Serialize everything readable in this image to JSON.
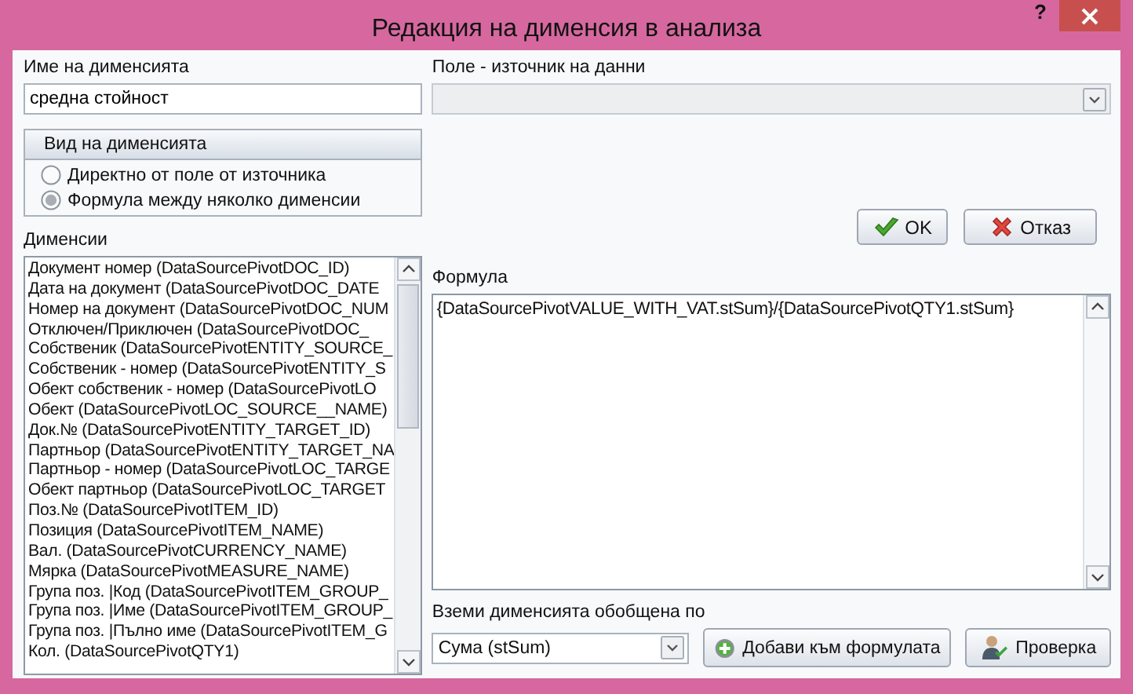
{
  "window": {
    "title": "Редакция на дименсия в анализа",
    "help": "?"
  },
  "name_field": {
    "label": "Име на дименсията",
    "value": "средна стойност"
  },
  "source_field": {
    "label": "Поле - източник на данни",
    "disabled": true
  },
  "dimension_type": {
    "title": "Вид на дименсията",
    "options": [
      {
        "label": "Директно от поле от източника",
        "selected": false
      },
      {
        "label": "Формула между няколко дименсии",
        "selected": true
      }
    ]
  },
  "buttons": [
    {
      "kind": "ok",
      "label": "OK"
    },
    {
      "kind": "cancel",
      "label": "Отказ"
    }
  ],
  "dimensions": {
    "label": "Дименсии",
    "items": [
      "Документ номер (DataSourcePivotDOC_ID)",
      "Дата на документ (DataSourcePivotDOC_DATE",
      "Номер на документ (DataSourcePivotDOC_NUM",
      "Отключен/Приключен (DataSourcePivotDOC_",
      "Собственик (DataSourcePivotENTITY_SOURCE_",
      "Собственик - номер (DataSourcePivotENTITY_S",
      "Обект собственик - номер (DataSourcePivotLO",
      "Обект (DataSourcePivotLOC_SOURCE__NAME)",
      "Док.№ (DataSourcePivotENTITY_TARGET_ID)",
      "Партньор (DataSourcePivotENTITY_TARGET_NA",
      "Партньор - номер (DataSourcePivotLOC_TARGE",
      "Обект партньор (DataSourcePivotLOC_TARGET",
      "Поз.№ (DataSourcePivotITEM_ID)",
      "Позиция (DataSourcePivotITEM_NAME)",
      "Вал. (DataSourcePivotCURRENCY_NAME)",
      "Мярка (DataSourcePivotMEASURE_NAME)",
      "Група поз. |Код (DataSourcePivotITEM_GROUP_",
      "Група поз. |Име (DataSourcePivotITEM_GROUP_",
      "Група поз. |Пълно име (DataSourcePivotITEM_G",
      "Кол. (DataSourcePivotQTY1)"
    ]
  },
  "formula": {
    "label": "Формула",
    "value": "{DataSourcePivotVALUE_WITH_VAT.stSum}/{DataSourcePivotQTY1.stSum}"
  },
  "aggregate": {
    "label": "Вземи дименсията обобщена по",
    "value": "Сума (stSum)"
  },
  "actions": [
    {
      "kind": "add",
      "label": "Добави към формулата"
    },
    {
      "kind": "check",
      "label": "Проверка"
    }
  ]
}
